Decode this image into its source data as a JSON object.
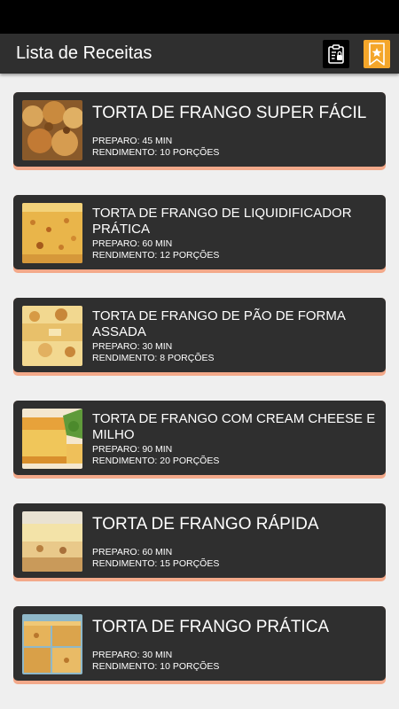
{
  "app_bar": {
    "title": "Lista de Receitas",
    "clipboard_icon": "clipboard-lock-icon",
    "bookmark_icon": "star-bookmark-icon",
    "bookmark_color": "#f4a62a"
  },
  "colors": {
    "card": "#2f2f2f",
    "card_accent": "#f3a98a",
    "background": "#efefef"
  },
  "recipes": [
    {
      "title": "TORTA DE FRANGO SUPER FÁCIL",
      "prep": "PREPARO: 45 MIN",
      "yield": "RENDIMENTO: 10 PORÇÕES"
    },
    {
      "title": "TORTA DE FRANGO DE LIQUIDIFICADOR PRÁTICA",
      "prep": "PREPARO: 60 MIN",
      "yield": "RENDIMENTO: 12 PORÇÕES"
    },
    {
      "title": "TORTA DE FRANGO DE PÃO DE FORMA ASSADA",
      "prep": "PREPARO: 30 MIN",
      "yield": "RENDIMENTO: 8 PORÇÕES"
    },
    {
      "title": "TORTA DE FRANGO COM CREAM CHEESE E MILHO",
      "prep": "PREPARO: 90 MIN",
      "yield": "RENDIMENTO: 20 PORÇÕES"
    },
    {
      "title": "TORTA DE FRANGO RÁPIDA",
      "prep": "PREPARO: 60 MIN",
      "yield": "RENDIMENTO: 15 PORÇÕES"
    },
    {
      "title": "TORTA DE FRANGO PRÁTICA",
      "prep": "PREPARO: 30 MIN",
      "yield": "RENDIMENTO: 10 PORÇÕES"
    }
  ]
}
